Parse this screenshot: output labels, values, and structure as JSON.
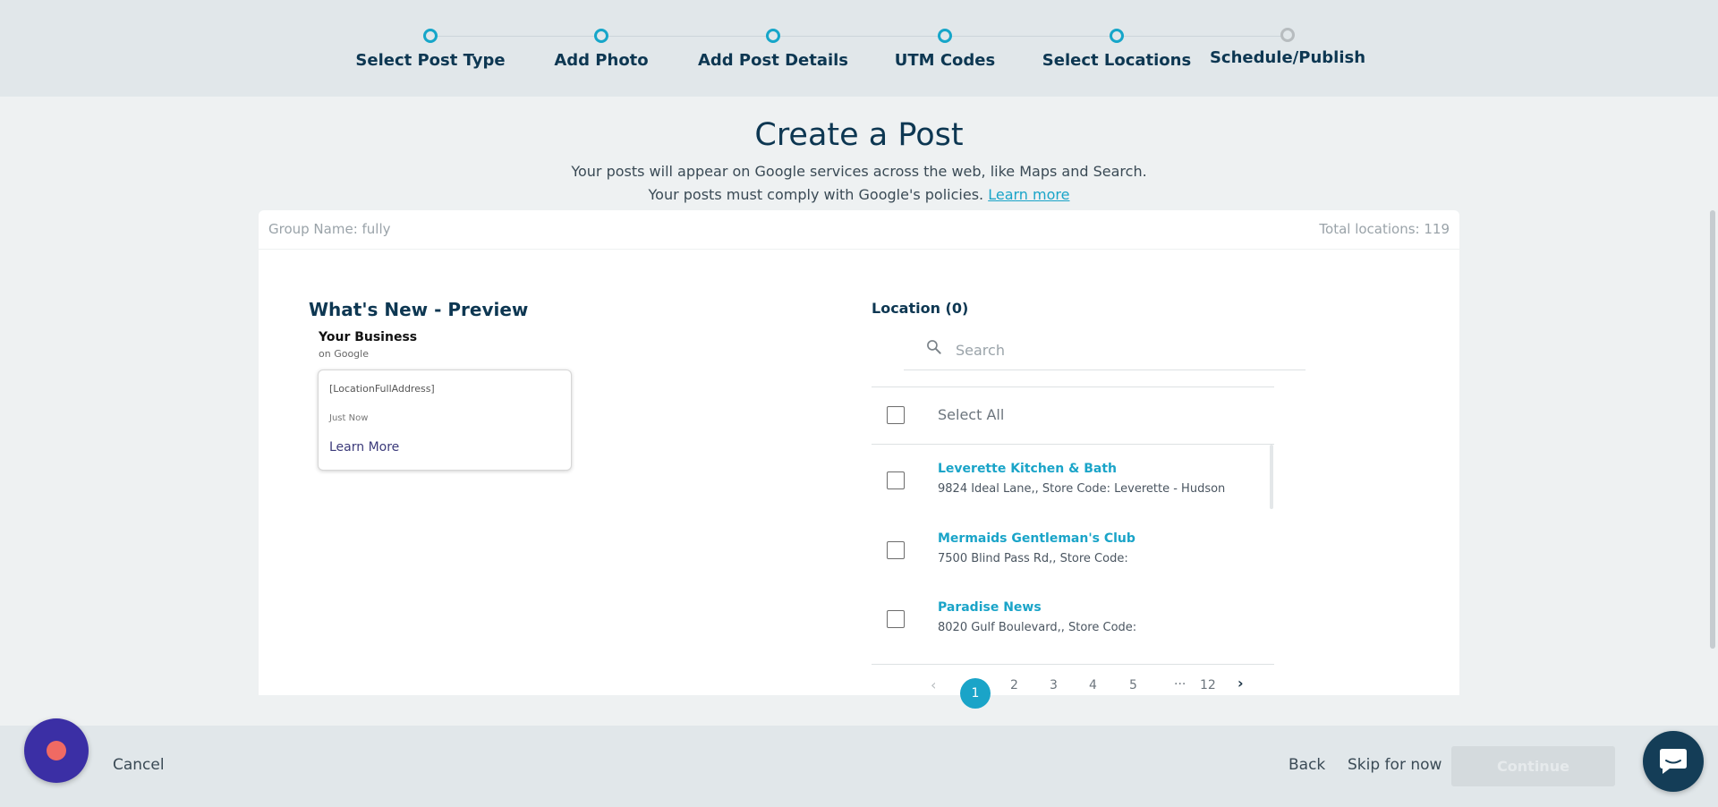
{
  "stepper": {
    "steps": [
      {
        "label": "Select Post Type",
        "status": "complete"
      },
      {
        "label": "Add Photo",
        "status": "complete"
      },
      {
        "label": "Add Post Details",
        "status": "complete"
      },
      {
        "label": "UTM Codes",
        "status": "complete"
      },
      {
        "label": "Select Locations",
        "status": "current"
      },
      {
        "label": "Schedule/Publish",
        "status": "pending"
      }
    ]
  },
  "header": {
    "title": "Create a Post",
    "subtitle_line1": "Your posts will appear on Google services across the web, like Maps and Search.",
    "subtitle_line2": "Your posts must comply with Google's policies.",
    "learn_more": "Learn more"
  },
  "card": {
    "group_name": "Group Name: fully",
    "total_locations": "Total locations: 119"
  },
  "preview": {
    "title": "What's New - Preview",
    "business_name": "Your Business",
    "business_sub": "on Google",
    "address_placeholder": "[LocationFullAddress]",
    "time": "Just Now",
    "learn_more": "Learn More"
  },
  "locations": {
    "title": "Location (0)",
    "search_placeholder": "Search",
    "select_all": "Select All",
    "items": [
      {
        "name": "Leverette Kitchen & Bath",
        "address": "9824 Ideal Lane,, Store Code: Leverette - Hudson"
      },
      {
        "name": "Mermaids Gentleman's Club",
        "address": "7500 Blind Pass Rd,, Store Code:"
      },
      {
        "name": "Paradise News",
        "address": "8020 Gulf Boulevard,, Store Code:"
      }
    ]
  },
  "pagination": {
    "prev": "‹",
    "current": "1",
    "pages": [
      "2",
      "3",
      "4",
      "5"
    ],
    "ellipsis": "...",
    "last": "12",
    "next": "›"
  },
  "footer": {
    "cancel": "Cancel",
    "back": "Back",
    "skip": "Skip for now",
    "continue": "Continue"
  },
  "colors": {
    "accent": "#1aa4c8",
    "brand_dark": "#0d3752",
    "record_button": "#3b2fa5",
    "chat_button": "#143d57"
  }
}
